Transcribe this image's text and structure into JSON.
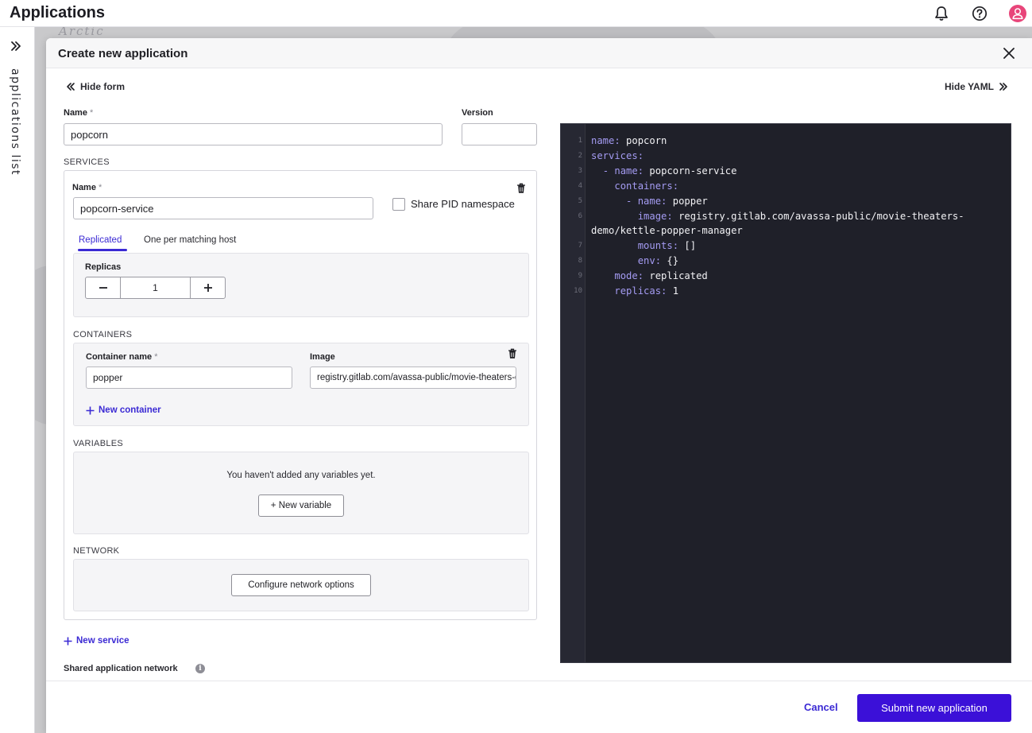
{
  "header": {
    "title": "Applications",
    "icons": [
      "bell-icon",
      "help-icon",
      "user-icon"
    ],
    "accent_color": "#e8457a"
  },
  "sidebar": {
    "label": "applications list"
  },
  "map": {
    "word": "Arctic"
  },
  "dialog": {
    "title": "Create new application",
    "hide_form": "Hide form",
    "hide_yaml": "Hide YAML",
    "name_label": "Name",
    "version_label": "Version",
    "name_value": "popcorn",
    "version_value": "",
    "required_mark": "*",
    "services_caption": "SERVICES",
    "service": {
      "name_label": "Name",
      "name_value": "popcorn-service",
      "share_pid_label": "Share PID namespace",
      "tabs": [
        "Replicated",
        "One per matching host"
      ],
      "active_tab": "Replicated",
      "replicas_label": "Replicas",
      "replicas_value": "1",
      "containers_caption": "CONTAINERS",
      "container_name_label": "Container name",
      "container_name_value": "popper",
      "image_label": "Image",
      "image_value": "registry.gitlab.com/avassa-public/movie-theaters-demo/kettle-popper-manager",
      "new_container": "New container",
      "variables_caption": "VARIABLES",
      "variables_empty": "You haven't added any variables yet.",
      "new_variable": "+ New variable",
      "network_caption": "NETWORK",
      "configure_network": "Configure network options"
    },
    "new_service": "New service",
    "shared_network_label": "Shared application network",
    "cancel": "Cancel",
    "submit": "Submit new application",
    "primary_color": "#3b10d8"
  },
  "yaml": {
    "line_numbers": [
      "1",
      "2",
      "3",
      "4",
      "5",
      "6",
      "7",
      "8",
      "9",
      "10"
    ],
    "lines": [
      {
        "indent": "",
        "key": "name:",
        "val": " popcorn"
      },
      {
        "indent": "",
        "key": "services:",
        "val": ""
      },
      {
        "indent": "  ",
        "key": "- name:",
        "val": " popcorn-service"
      },
      {
        "indent": "    ",
        "key": "containers:",
        "val": ""
      },
      {
        "indent": "      ",
        "key": "- name:",
        "val": " popper"
      },
      {
        "indent": "        ",
        "key": "image:",
        "val": " registry.gitlab.com/avassa-public/movie-theaters-"
      },
      {
        "indent": "",
        "key": "",
        "val": "demo/kettle-popper-manager"
      },
      {
        "indent": "        ",
        "key": "mounts:",
        "val": " []"
      },
      {
        "indent": "        ",
        "key": "env:",
        "val": " {}"
      },
      {
        "indent": "    ",
        "key": "mode:",
        "val": " replicated"
      },
      {
        "indent": "    ",
        "key": "replicas:",
        "val": " 1"
      }
    ]
  }
}
